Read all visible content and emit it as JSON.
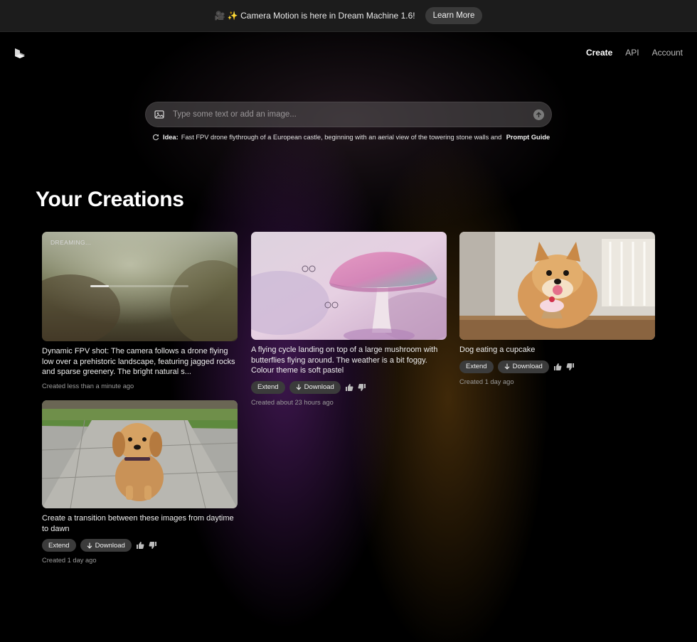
{
  "banner": {
    "text": "🎥 ✨ Camera Motion is here in Dream Machine 1.6!",
    "button_label": "Learn More"
  },
  "nav": {
    "links": [
      {
        "label": "Create",
        "active": true
      },
      {
        "label": "API",
        "active": false
      },
      {
        "label": "Account",
        "active": false
      }
    ]
  },
  "prompt": {
    "placeholder": "Type some text or add an image...",
    "value": "",
    "idea_label": "Idea:",
    "idea_text": "Fast FPV drone flythrough of a European castle, beginning with an aerial view of the towering stone walls and tu...",
    "guide_label": "Prompt Guide"
  },
  "section": {
    "title": "Your Creations"
  },
  "creations": [
    {
      "status": "DREAMING...",
      "progress": 0.19,
      "caption": "Dynamic FPV shot: The camera follows a drone flying low over a prehistoric landscape, featuring jagged rocks and sparse greenery. The bright natural s...",
      "created": "Created less than a minute ago"
    },
    {
      "caption": "A flying cycle landing on top of a large mushroom with butterflies flying around. The weather is a bit foggy. Colour theme is soft pastel",
      "extend_label": "Extend",
      "download_label": "Download",
      "created": "Created about 23 hours ago"
    },
    {
      "caption": "Dog eating a cupcake",
      "extend_label": "Extend",
      "download_label": "Download",
      "created": "Created 1 day ago"
    },
    {
      "caption": "Create a transition between these images from daytime to dawn",
      "extend_label": "Extend",
      "download_label": "Download",
      "created": "Created 1 day ago"
    }
  ],
  "colors": {
    "banner_bg": "#1c1c1c",
    "pill_bg": "#3b3b3b",
    "accent_purple": "#6e288c",
    "accent_amber": "#8c5a14"
  }
}
